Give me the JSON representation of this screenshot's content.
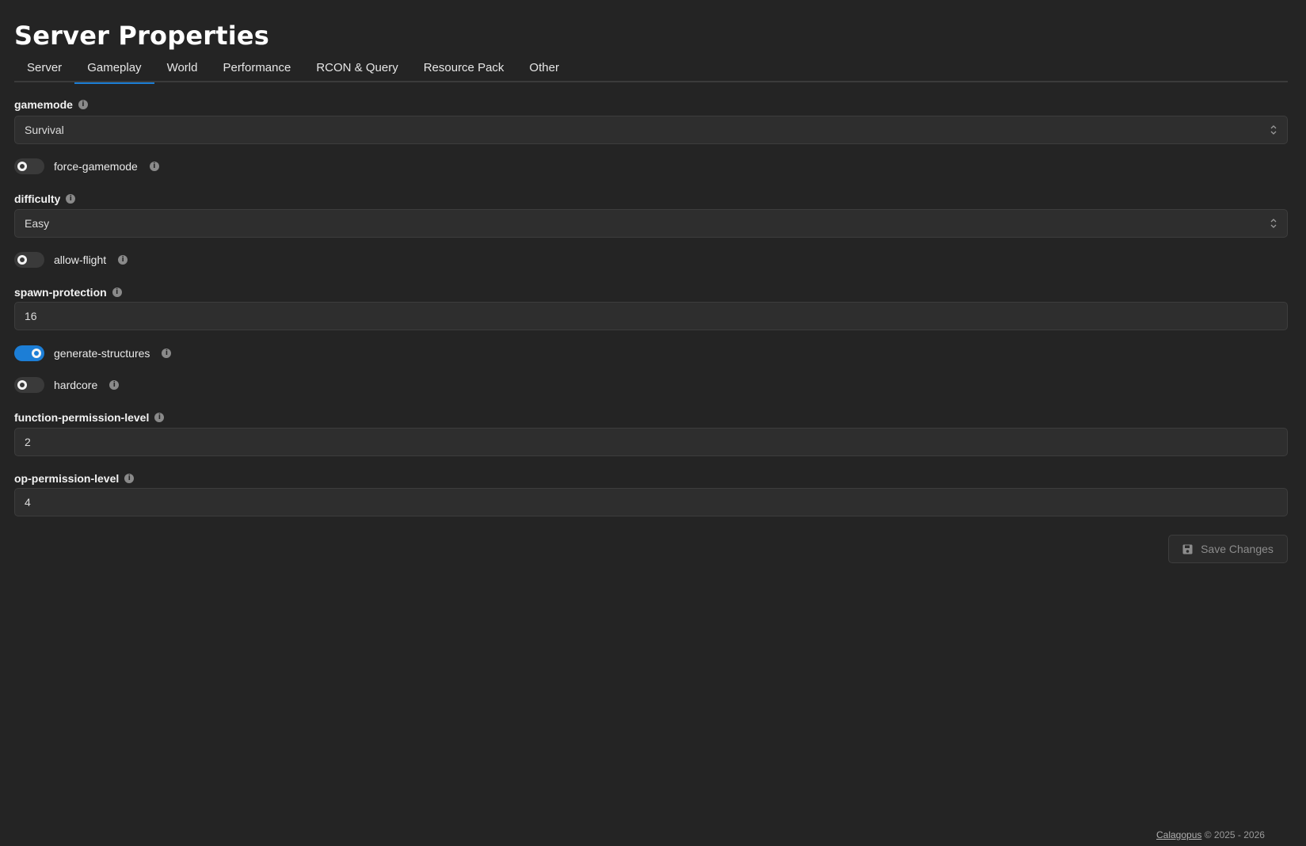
{
  "page": {
    "title": "Server Properties"
  },
  "tabs": [
    {
      "label": "Server",
      "active": false
    },
    {
      "label": "Gameplay",
      "active": true
    },
    {
      "label": "World",
      "active": false
    },
    {
      "label": "Performance",
      "active": false
    },
    {
      "label": "RCON & Query",
      "active": false
    },
    {
      "label": "Resource Pack",
      "active": false
    },
    {
      "label": "Other",
      "active": false
    }
  ],
  "fields": {
    "gamemode": {
      "label": "gamemode",
      "value": "Survival"
    },
    "force_gamemode": {
      "label": "force-gamemode",
      "checked": false
    },
    "difficulty": {
      "label": "difficulty",
      "value": "Easy"
    },
    "allow_flight": {
      "label": "allow-flight",
      "checked": false
    },
    "spawn_protection": {
      "label": "spawn-protection",
      "value": "16"
    },
    "generate_structures": {
      "label": "generate-structures",
      "checked": true
    },
    "hardcore": {
      "label": "hardcore",
      "checked": false
    },
    "function_permission_level": {
      "label": "function-permission-level",
      "value": "2"
    },
    "op_permission_level": {
      "label": "op-permission-level",
      "value": "4"
    }
  },
  "info_glyph": "i",
  "actions": {
    "save_label": "Save Changes"
  },
  "footer": {
    "link": "Calagopus",
    "copyright": "© 2025 - 2026"
  },
  "colors": {
    "accent": "#1c7ed6",
    "background": "#242424",
    "input_bg": "#2e2e2e"
  }
}
